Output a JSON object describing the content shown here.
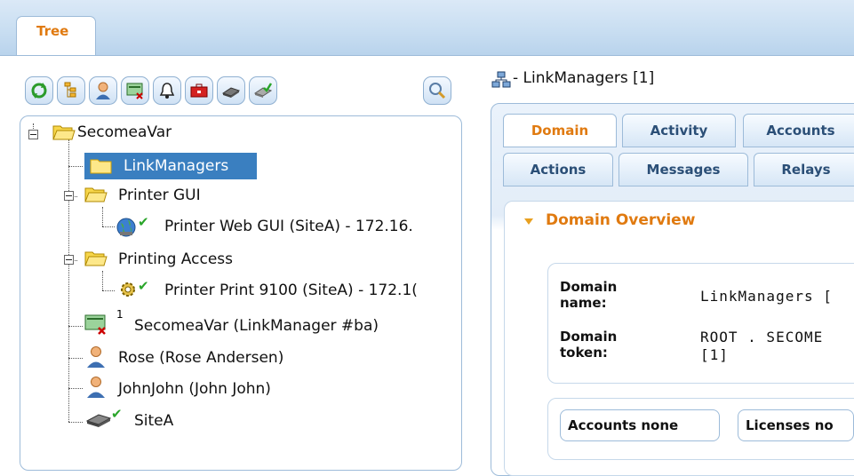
{
  "top_tabs": [
    {
      "label": "Tree"
    }
  ],
  "toolbar": {
    "buttons": [
      {
        "name": "refresh-icon"
      },
      {
        "name": "tree-view-icon"
      },
      {
        "name": "user-icon"
      },
      {
        "name": "linkmanager-icon"
      },
      {
        "name": "bell-icon"
      },
      {
        "name": "toolbox-icon"
      },
      {
        "name": "device-icon"
      },
      {
        "name": "device-check-icon"
      }
    ],
    "search": {
      "name": "search-icon"
    }
  },
  "tree": {
    "nodes": [
      {
        "label": "SecomeaVar",
        "icon": "folder-open-icon"
      },
      {
        "label": "LinkManagers",
        "icon": "folder-icon",
        "selected": true
      },
      {
        "label": "Printer GUI",
        "icon": "folder-open-icon"
      },
      {
        "label": "Printer Web GUI (SiteA) - 172.16.",
        "icon": "globe-icon",
        "check": true
      },
      {
        "label": "Printing Access",
        "icon": "folder-open-icon"
      },
      {
        "label": "Printer Print 9100 (SiteA) - 172.1(",
        "icon": "gear-icon",
        "check": true
      },
      {
        "label": "SecomeaVar (LinkManager #ba)",
        "icon": "linkmanager-icon",
        "superscript": "1"
      },
      {
        "label": "Rose (Rose Andersen)",
        "icon": "user-icon"
      },
      {
        "label": "JohnJohn (John John)",
        "icon": "user-icon"
      },
      {
        "label": "SiteA",
        "icon": "device-icon",
        "check": true
      }
    ]
  },
  "right": {
    "header": "- LinkManagers [1]",
    "tabs_row1": [
      {
        "label": "Domain",
        "active": true
      },
      {
        "label": "Activity"
      },
      {
        "label": "Accounts"
      }
    ],
    "tabs_row2": [
      {
        "label": "Actions"
      },
      {
        "label": "Messages"
      },
      {
        "label": "Relays"
      }
    ],
    "overview": {
      "title": "Domain Overview",
      "name_key": "Domain name:",
      "name_value": "LinkManagers [",
      "token_key": "Domain token:",
      "token_value_1": "ROOT . SECOME",
      "token_value_2": "[1]",
      "accounts_pill": "Accounts none",
      "licenses_pill": "Licenses no"
    }
  },
  "colors": {
    "accent": "#e07a10",
    "selection": "#3a7fc0",
    "border": "#9dbbd9",
    "check": "#2aa52a"
  }
}
